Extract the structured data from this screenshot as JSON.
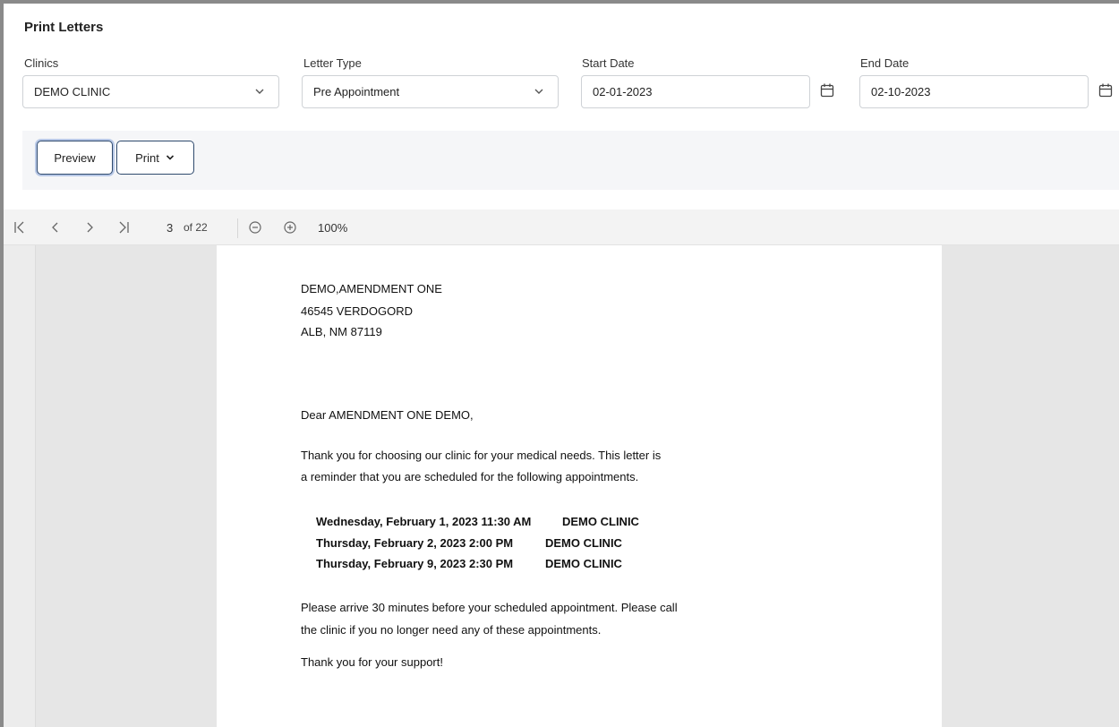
{
  "page_title": "Print Letters",
  "filters": {
    "clinics": {
      "label": "Clinics",
      "value": "DEMO CLINIC"
    },
    "letter_type": {
      "label": "Letter Type",
      "value": "Pre Appointment"
    },
    "start_date": {
      "label": "Start Date",
      "value": "02-01-2023"
    },
    "end_date": {
      "label": "End Date",
      "value": "02-10-2023"
    }
  },
  "actions": {
    "preview_label": "Preview",
    "print_label": "Print"
  },
  "viewer": {
    "current_page": "3",
    "total_pages": "of 22",
    "zoom": "100%"
  },
  "letter": {
    "address_line1": "DEMO,AMENDMENT ONE",
    "address_line2": "46545 VERDOGORD",
    "address_line3": "ALB, NM 87119",
    "salutation": "Dear AMENDMENT ONE DEMO,",
    "intro_line1": "Thank you for choosing our clinic for your medical needs. This letter is",
    "intro_line2": "a reminder that you are scheduled for the following appointments.",
    "appointments": [
      {
        "datetime": "Wednesday, February 1, 2023 11:30 AM",
        "clinic": "DEMO CLINIC"
      },
      {
        "datetime": "Thursday, February 2, 2023 2:00 PM",
        "clinic": "DEMO CLINIC"
      },
      {
        "datetime": "Thursday, February 9, 2023 2:30 PM",
        "clinic": "DEMO CLINIC"
      }
    ],
    "closing_line1": "Please arrive 30 minutes before your scheduled appointment. Please call",
    "closing_line2": "the clinic if you no longer need any of these appointments.",
    "thanks": "Thank you for your support!"
  }
}
